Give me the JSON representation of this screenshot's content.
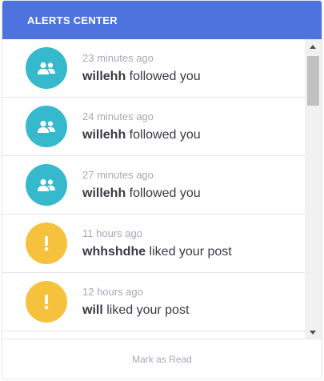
{
  "header": {
    "title": "ALERTS CENTER"
  },
  "colors": {
    "accent": "#4e73df",
    "info": "#36b9cc",
    "warning": "#f6c23e"
  },
  "alerts": [
    {
      "icon": "users-icon",
      "type": "info",
      "time": "23 minutes ago",
      "user": "willehh",
      "action": " followed you"
    },
    {
      "icon": "users-icon",
      "type": "info",
      "time": "24 minutes ago",
      "user": "willehh",
      "action": " followed you"
    },
    {
      "icon": "users-icon",
      "type": "info",
      "time": "27 minutes ago",
      "user": "willehh",
      "action": " followed you"
    },
    {
      "icon": "exclamation-icon",
      "type": "warning",
      "time": "11 hours ago",
      "user": "whhshdhe",
      "action": " liked your post"
    },
    {
      "icon": "exclamation-icon",
      "type": "warning",
      "time": "12 hours ago",
      "user": "will",
      "action": " liked your post"
    }
  ],
  "footer": {
    "mark_read_label": "Mark as Read"
  }
}
